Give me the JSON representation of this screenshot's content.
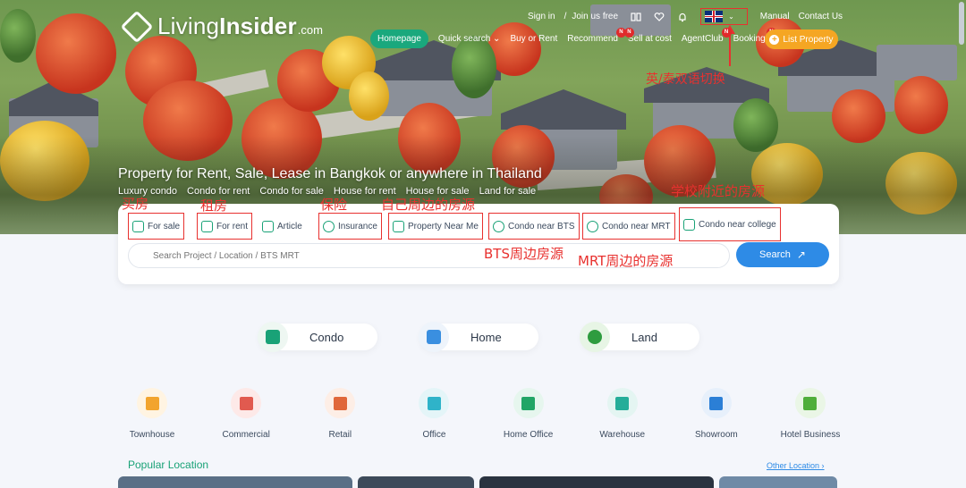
{
  "header": {
    "logo_main": "Living",
    "logo_bold": "Insider",
    "logo_domain": ".com",
    "signin": "Sign in",
    "join": "Join us free",
    "manual": "Manual",
    "contact": "Contact Us"
  },
  "nav": {
    "items": [
      "Homepage",
      "Quick search",
      "Buy or Rent",
      "Recommend",
      "Sell at cost",
      "AgentClub",
      "Booking"
    ],
    "list_property": "List Property",
    "badge": "N"
  },
  "hero": {
    "title": "Property for Rent, Sale, Lease in Bangkok or anywhere in Thailand",
    "links": [
      "Luxury condo",
      "Condo for rent",
      "Condo for sale",
      "House for rent",
      "House for sale",
      "Land for sale"
    ]
  },
  "search": {
    "tabs": [
      "For sale",
      "For rent",
      "Article",
      "Insurance",
      "Property Near Me",
      "Condo near BTS",
      "Condo near MRT",
      "Condo near college"
    ],
    "placeholder": "Search Project / Location / BTS MRT",
    "button": "Search"
  },
  "annotations": {
    "lang_switch": "英/泰双语切换",
    "buy": "买房",
    "rent": "租房",
    "insurance": "保险",
    "near_me": "自己周边的房源",
    "college": "学校附近的房源",
    "bts": "BTS周边房源",
    "mrt": "MRT周边的房源"
  },
  "categories": [
    "Condo",
    "Home",
    "Land"
  ],
  "types": [
    "Townhouse",
    "Commercial",
    "Retail",
    "Office",
    "Home Office",
    "Warehouse",
    "Showroom",
    "Hotel Business"
  ],
  "popular": {
    "title": "Popular Location",
    "other": "Other Location ›"
  },
  "colors": {
    "brand_green": "#19a277",
    "accent_orange": "#f5a623",
    "search_blue": "#2e8be6",
    "annotation_red": "#e8312f"
  }
}
